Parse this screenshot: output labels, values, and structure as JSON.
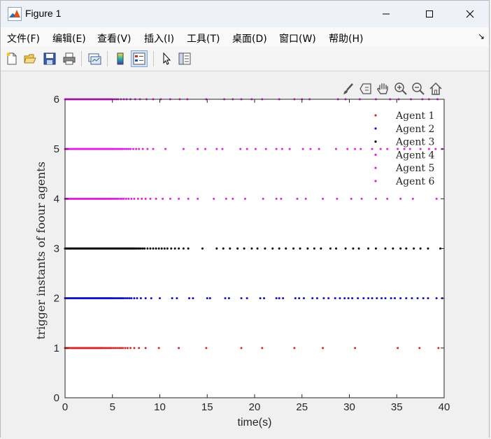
{
  "window": {
    "title": "Figure 1"
  },
  "menu": {
    "items": [
      "文件(F)",
      "编辑(E)",
      "查看(V)",
      "插入(I)",
      "工具(T)",
      "桌面(D)",
      "窗口(W)",
      "帮助(H)"
    ],
    "more_glyph": "↘"
  },
  "toolbar": {
    "buttons": [
      "new-figure-icon",
      "open-file-icon",
      "save-icon",
      "print-icon",
      "link-plot-icon",
      "colorbar-icon",
      "legend-icon",
      "pointer-icon",
      "property-inspector-icon"
    ]
  },
  "axes_toolbar": {
    "buttons": [
      "brush-icon",
      "data-tips-icon",
      "pan-icon",
      "zoom-in-icon",
      "zoom-out-icon",
      "home-icon"
    ]
  },
  "colors": {
    "agent1": "#d62728",
    "agent2": "#1010c8",
    "agent3": "#000000",
    "agent4": "#e020e0",
    "agent5": "#e020e0",
    "agent6": "#e020e0"
  },
  "chart_data": {
    "type": "scatter",
    "title": "",
    "xlabel": "time(s)",
    "ylabel": "trigger instants of foour agents",
    "xlim": [
      0,
      40
    ],
    "ylim": [
      0,
      6
    ],
    "xticks": [
      0,
      5,
      10,
      15,
      20,
      25,
      30,
      35,
      40
    ],
    "yticks": [
      0,
      1,
      2,
      3,
      4,
      5,
      6
    ],
    "grid": false,
    "legend": "top-right",
    "series": [
      {
        "name": "Agent 1",
        "y": 1,
        "color": "#d62728",
        "x": [
          0,
          0.1,
          0.2,
          0.3,
          0.4,
          0.5,
          0.6,
          0.7,
          0.8,
          0.9,
          1.0,
          1.1,
          1.2,
          1.3,
          1.4,
          1.5,
          1.6,
          1.7,
          1.8,
          1.9,
          2.0,
          2.1,
          2.2,
          2.3,
          2.4,
          2.5,
          2.6,
          2.7,
          2.8,
          2.9,
          3.0,
          3.1,
          3.2,
          3.3,
          3.4,
          3.5,
          3.6,
          3.7,
          3.8,
          3.9,
          4.0,
          4.15,
          4.3,
          4.45,
          4.6,
          4.75,
          4.9,
          5.1,
          5.3,
          5.5,
          5.7,
          5.9,
          6.1,
          6.35,
          6.6,
          6.9,
          7.3,
          7.8,
          8.5,
          9.9,
          12.0,
          14.9,
          18.6,
          20.8,
          24.2,
          27.2,
          30.6,
          35.1,
          37.4,
          39.4
        ]
      },
      {
        "name": "Agent 2",
        "y": 2,
        "color": "#1010c8",
        "x": [
          0,
          0.1,
          0.2,
          0.3,
          0.4,
          0.5,
          0.6,
          0.7,
          0.8,
          0.9,
          1.0,
          1.1,
          1.2,
          1.3,
          1.4,
          1.5,
          1.6,
          1.7,
          1.8,
          1.9,
          2.0,
          2.1,
          2.2,
          2.3,
          2.4,
          2.5,
          2.6,
          2.7,
          2.8,
          2.9,
          3.0,
          3.1,
          3.2,
          3.3,
          3.4,
          3.5,
          3.6,
          3.7,
          3.8,
          3.9,
          4.0,
          4.1,
          4.2,
          4.3,
          4.4,
          4.5,
          4.6,
          4.7,
          4.8,
          4.9,
          5.0,
          5.15,
          5.3,
          5.45,
          5.6,
          5.75,
          5.9,
          6.05,
          6.2,
          6.4,
          6.6,
          6.8,
          7.0,
          7.3,
          7.6,
          8.0,
          8.5,
          9.1,
          10.0,
          11.3,
          11.8,
          13.1,
          13.5,
          15.0,
          15.3,
          16.9,
          17.3,
          18.6,
          19.2,
          20.6,
          21.0,
          22.3,
          22.6,
          23.0,
          24.3,
          24.7,
          25.2,
          26.1,
          26.6,
          27.3,
          27.8,
          28.5,
          29.0,
          29.5,
          29.9,
          30.3,
          30.9,
          31.5,
          32.0,
          32.4,
          32.9,
          33.4,
          33.8,
          34.4,
          34.8,
          35.4,
          36.0,
          36.6,
          37.2,
          37.8,
          38.3,
          39.2,
          39.8
        ]
      },
      {
        "name": "Agent 3",
        "y": 3,
        "color": "#000000",
        "x": [
          0,
          0.1,
          0.2,
          0.3,
          0.4,
          0.5,
          0.6,
          0.7,
          0.8,
          0.9,
          1.0,
          1.1,
          1.2,
          1.3,
          1.4,
          1.5,
          1.6,
          1.7,
          1.8,
          1.9,
          2.0,
          2.1,
          2.2,
          2.3,
          2.4,
          2.5,
          2.6,
          2.7,
          2.8,
          2.9,
          3.0,
          3.1,
          3.2,
          3.3,
          3.4,
          3.5,
          3.6,
          3.7,
          3.8,
          3.9,
          4.0,
          4.1,
          4.2,
          4.3,
          4.4,
          4.5,
          4.6,
          4.7,
          4.8,
          4.9,
          5.0,
          5.1,
          5.2,
          5.3,
          5.4,
          5.5,
          5.6,
          5.7,
          5.8,
          5.9,
          6.0,
          6.1,
          6.2,
          6.3,
          6.4,
          6.5,
          6.6,
          6.7,
          6.8,
          6.9,
          7.0,
          7.1,
          7.2,
          7.3,
          7.4,
          7.55,
          7.7,
          7.85,
          8.0,
          8.2,
          8.4,
          8.7,
          9.0,
          9.3,
          9.6,
          9.9,
          10.2,
          10.5,
          10.8,
          11.2,
          11.6,
          12.0,
          12.5,
          13.0,
          14.5,
          16.0,
          16.7,
          17.4,
          18.2,
          18.9,
          19.7,
          20.3,
          21.1,
          21.9,
          22.6,
          23.3,
          24.1,
          24.8,
          25.6,
          26.3,
          27.0,
          28.0,
          28.6,
          29.6,
          30.4,
          31.0,
          32.0,
          32.8,
          33.8,
          34.6,
          35.4,
          36.0,
          36.8,
          37.5,
          38.3,
          39.6
        ]
      },
      {
        "name": "Agent 4",
        "y": 4,
        "color": "#e020e0",
        "x": [
          0,
          0.1,
          0.2,
          0.3,
          0.4,
          0.5,
          0.6,
          0.7,
          0.8,
          0.9,
          1.0,
          1.1,
          1.2,
          1.3,
          1.4,
          1.5,
          1.6,
          1.7,
          1.8,
          1.9,
          2.0,
          2.1,
          2.2,
          2.3,
          2.4,
          2.5,
          2.6,
          2.7,
          2.8,
          2.9,
          3.0,
          3.1,
          3.2,
          3.3,
          3.4,
          3.5,
          3.6,
          3.7,
          3.8,
          3.9,
          4.0,
          4.1,
          4.2,
          4.3,
          4.4,
          4.5,
          4.6,
          4.7,
          4.8,
          4.9,
          5.0,
          5.15,
          5.3,
          5.45,
          5.6,
          5.8,
          6.0,
          6.2,
          6.45,
          6.7,
          7.0,
          7.3,
          7.7,
          8.1,
          8.5,
          9.0,
          9.6,
          10.3,
          11.1,
          12.0,
          13.0,
          14.0,
          15.7,
          17.0,
          17.7,
          19.0,
          20.9,
          22.3,
          22.8,
          24.5,
          25.4,
          27.2,
          28.7,
          30.2,
          31.3,
          32.8,
          34.0,
          35.4,
          36.7,
          39.2
        ]
      },
      {
        "name": "Agent 5",
        "y": 5,
        "color": "#e020e0",
        "x": [
          0,
          0.1,
          0.2,
          0.3,
          0.4,
          0.5,
          0.6,
          0.7,
          0.8,
          0.9,
          1.0,
          1.1,
          1.2,
          1.3,
          1.4,
          1.5,
          1.6,
          1.7,
          1.8,
          1.9,
          2.0,
          2.1,
          2.2,
          2.3,
          2.4,
          2.5,
          2.6,
          2.7,
          2.8,
          2.9,
          3.0,
          3.1,
          3.2,
          3.3,
          3.4,
          3.5,
          3.6,
          3.7,
          3.8,
          3.9,
          4.0,
          4.1,
          4.2,
          4.3,
          4.4,
          4.5,
          4.6,
          4.7,
          4.8,
          4.9,
          5.0,
          5.1,
          5.2,
          5.35,
          5.5,
          5.65,
          5.8,
          5.95,
          6.1,
          6.3,
          6.5,
          6.7,
          6.9,
          7.2,
          7.5,
          7.8,
          8.2,
          8.7,
          9.3,
          10.6,
          12.5,
          14.0,
          14.8,
          16.0,
          16.6,
          18.5,
          19.2,
          20.1,
          21.2,
          22.3,
          22.9,
          23.7,
          25.1,
          25.9,
          26.8,
          28.6,
          29.8,
          30.6,
          31.2,
          32.4,
          33.3,
          34.0,
          35.1,
          35.8,
          36.4,
          37.5,
          38.4,
          39.1,
          39.8
        ]
      },
      {
        "name": "Agent 6",
        "y": 6,
        "color": "#e020e0",
        "x": [
          0,
          0.1,
          0.2,
          0.3,
          0.4,
          0.5,
          0.6,
          0.7,
          0.8,
          0.9,
          1.0,
          1.1,
          1.2,
          1.3,
          1.4,
          1.5,
          1.6,
          1.7,
          1.8,
          1.9,
          2.0,
          2.1,
          2.2,
          2.3,
          2.4,
          2.5,
          2.6,
          2.7,
          2.8,
          2.9,
          3.0,
          3.1,
          3.2,
          3.3,
          3.4,
          3.5,
          3.6,
          3.7,
          3.8,
          3.9,
          4.0,
          4.1,
          4.2,
          4.3,
          4.4,
          4.5,
          4.6,
          4.7,
          4.8,
          4.9,
          5.0,
          5.2,
          5.4,
          5.6,
          5.9,
          6.2,
          6.5,
          6.9,
          7.4,
          7.9,
          8.6,
          9.3,
          10.1,
          11.1,
          12.1,
          12.9,
          14.9,
          16.8,
          17.7,
          18.6,
          19.7,
          20.8,
          22.6,
          24.2,
          25.0,
          25.8,
          28.8,
          29.6,
          31.1,
          32.8,
          34.3,
          35.2,
          36.5,
          37.7,
          38.4,
          39.3
        ]
      }
    ]
  }
}
